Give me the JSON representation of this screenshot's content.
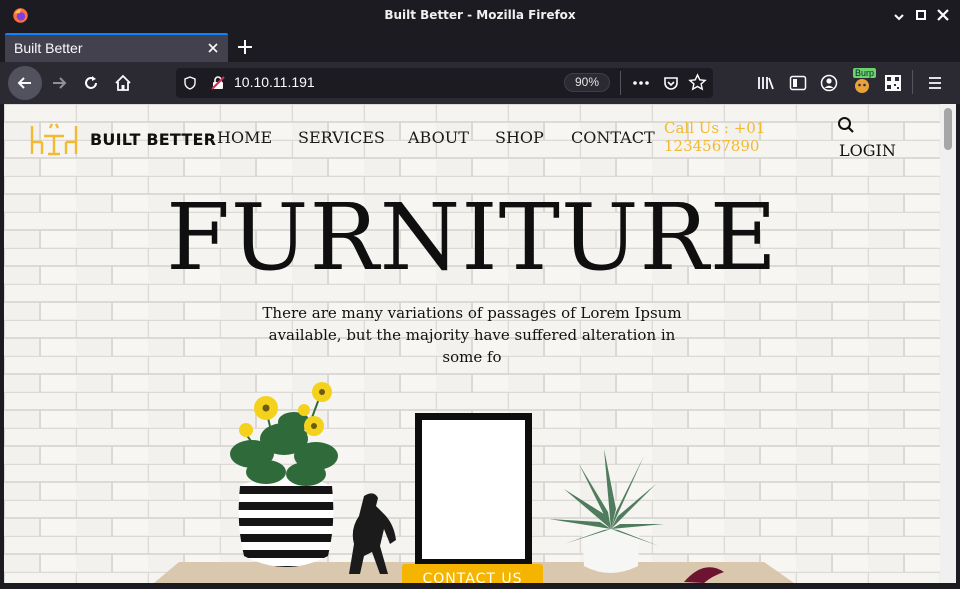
{
  "window": {
    "title": "Built Better - Mozilla Firefox"
  },
  "tabs": [
    {
      "label": "Built Better",
      "active": true
    }
  ],
  "toolbar": {
    "url": "10.10.11.191",
    "zoom": "90%",
    "burp_badge": "Burp"
  },
  "page": {
    "brand": "BUILT BETTER",
    "nav": [
      "HOME",
      "SERVICES",
      "ABOUT",
      "SHOP",
      "CONTACT"
    ],
    "call": "Call Us : +01 1234567890",
    "login": "LOGIN",
    "hero_title": "FURNITURE",
    "hero_text": "There are many variations of passages of Lorem Ipsum available, but the majority have suffered alteration in some fo",
    "cta": "CONTACT US"
  },
  "colors": {
    "accent": "#f3b92f",
    "tab_highlight": "#0a84ff",
    "chrome_dark": "#1c1b22",
    "toolbar": "#2b2a33"
  }
}
